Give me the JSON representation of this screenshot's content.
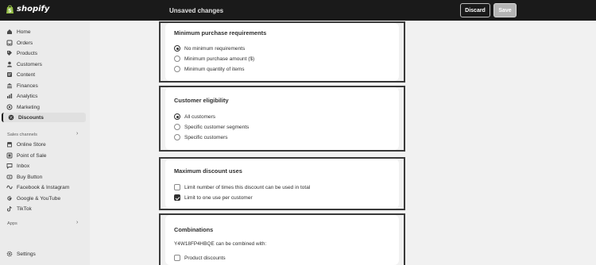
{
  "topbar": {
    "logo_text": "shopify",
    "status": "Unsaved changes",
    "discard_label": "Discard",
    "save_label": "Save"
  },
  "sidebar": {
    "items": [
      {
        "label": "Home",
        "icon": "home-icon"
      },
      {
        "label": "Orders",
        "icon": "inbox-icon"
      },
      {
        "label": "Products",
        "icon": "tag-icon"
      },
      {
        "label": "Customers",
        "icon": "person-icon"
      },
      {
        "label": "Content",
        "icon": "content-icon"
      },
      {
        "label": "Finances",
        "icon": "bank-icon"
      },
      {
        "label": "Analytics",
        "icon": "chart-icon"
      },
      {
        "label": "Marketing",
        "icon": "target-icon"
      },
      {
        "label": "Discounts",
        "icon": "discount-icon"
      }
    ],
    "sales_channels_label": "Sales channels",
    "channels": [
      {
        "label": "Online Store",
        "icon": "store-icon"
      },
      {
        "label": "Point of Sale",
        "icon": "pos-icon"
      },
      {
        "label": "Inbox",
        "icon": "chat-icon"
      },
      {
        "label": "Buy Button",
        "icon": "button-icon"
      },
      {
        "label": "Facebook & Instagram",
        "icon": "meta-icon"
      },
      {
        "label": "Google & YouTube",
        "icon": "google-icon"
      },
      {
        "label": "TikTok",
        "icon": "tiktok-icon"
      }
    ],
    "apps_label": "Apps",
    "settings_label": "Settings",
    "active_item": "Discounts"
  },
  "min_purchase": {
    "title": "Minimum purchase requirements",
    "options": [
      "No minimum requirements",
      "Minimum purchase amount ($)",
      "Minimum quantity of items"
    ],
    "selected": 0
  },
  "eligibility": {
    "title": "Customer eligibility",
    "options": [
      "All customers",
      "Specific customer segments",
      "Specific customers"
    ],
    "selected": 0
  },
  "max_uses": {
    "title": "Maximum discount uses",
    "options": [
      "Limit number of times this discount can be used in total",
      "Limit to one use per customer"
    ],
    "checked": [
      false,
      true
    ]
  },
  "combinations": {
    "title": "Combinations",
    "description": "Y4W18FP4HBQE can be combined with:",
    "options": [
      "Product discounts"
    ],
    "checked": [
      false
    ]
  },
  "colors": {
    "topbar": "#1a1a1a",
    "background": "#f1f1f1",
    "card": "#ffffff"
  }
}
